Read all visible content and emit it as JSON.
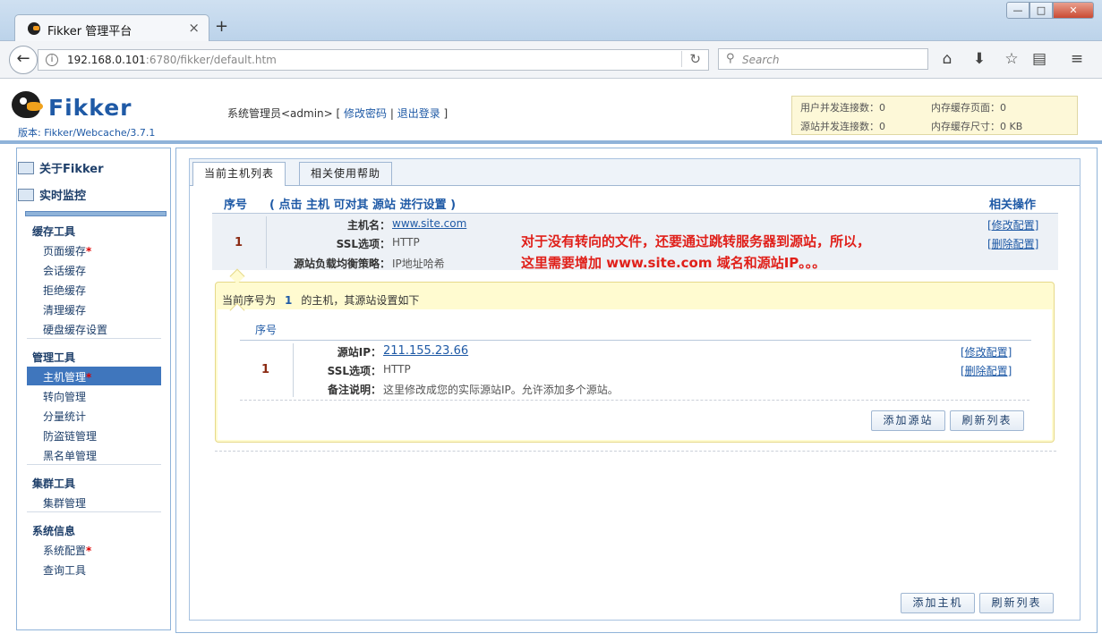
{
  "browser": {
    "tab_title": "Fikker 管理平台",
    "tab_close": "×",
    "new_tab": "+",
    "url_host": "192.168.0.101",
    "url_rest": ":6780/fikker/default.htm",
    "search_placeholder": "Search",
    "win_min": "—",
    "win_max": "□",
    "win_close": "✕"
  },
  "header": {
    "logo_text": "Fikker",
    "version": "版本: Fikker/Webcache/3.7.1",
    "admin_prefix": "系统管理员<admin> [ ",
    "change_password": "修改密码",
    "separator": " | ",
    "logout": "退出登录",
    "admin_suffix": " ]",
    "stats": {
      "user_conn": "用户并发连接数：0",
      "mem_pages": "内存缓存页面：0",
      "origin_conn": "源站并发连接数：0",
      "mem_size": "内存缓存尺寸：0 KB"
    }
  },
  "sidebar": {
    "about": "关于Fikker",
    "monitor": "实时监控",
    "sections": [
      {
        "title": "缓存工具",
        "items": [
          "页面缓存",
          "会话缓存",
          "拒绝缓存",
          "清理缓存",
          "硬盘缓存设置"
        ]
      },
      {
        "title": "管理工具",
        "items": [
          "主机管理",
          "转向管理",
          "分量统计",
          "防盗链管理",
          "黑名单管理"
        ]
      },
      {
        "title": "集群工具",
        "items": [
          "集群管理"
        ]
      },
      {
        "title": "系统信息",
        "items": [
          "系统配置",
          "查询工具"
        ]
      }
    ],
    "required_mark": "*"
  },
  "main": {
    "tabs": [
      "当前主机列表",
      "相关使用帮助"
    ],
    "col_index": "序号",
    "col_hint": "( 点击 主机 可对其 源站 进行设置 )",
    "col_ops": "相关操作",
    "host": {
      "index": "1",
      "hostname_label": "主机名：",
      "hostname_value": "www.site.com",
      "ssl_label": "SSL选项：",
      "ssl_value": "HTTP",
      "lb_label": "源站负载均衡策略：",
      "lb_value": "IP地址哈希",
      "edit": "[修改配置]",
      "delete": "[删除配置]"
    },
    "annotation_line1": "对于没有转向的文件，还要通过跳转服务器到源站，所以，",
    "annotation_line2": "这里需要增加 www.site.com 域名和源站IP。。。",
    "origin_caption_pre": "当前序号为",
    "origin_caption_num": "1",
    "origin_caption_post": "的主机，其源站设置如下",
    "origin": {
      "col_index": "序号",
      "index": "1",
      "ip_label": "源站IP：",
      "ip_value": "211.155.23.66",
      "ssl_label": "SSL选项：",
      "ssl_value": "HTTP",
      "remark_label": "备注说明：",
      "remark_value": "这里修改成您的实际源站IP。允许添加多个源站。",
      "edit": "[修改配置]",
      "delete": "[删除配置]",
      "add_btn": "添加源站",
      "refresh_btn": "刷新列表"
    },
    "add_host_btn": "添加主机",
    "refresh_btn": "刷新列表"
  }
}
